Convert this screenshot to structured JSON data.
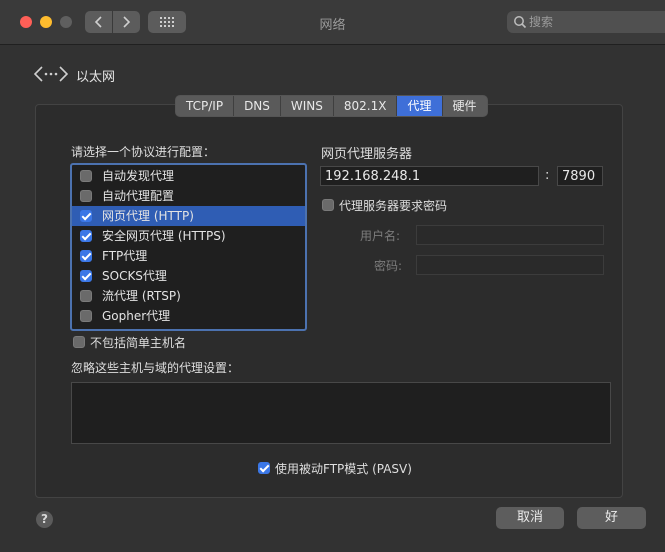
{
  "window": {
    "title": "网络",
    "search_placeholder": "搜索"
  },
  "interface": {
    "name": "以太网",
    "icon": "ethernet-icon"
  },
  "tabs": [
    {
      "label": "TCP/IP",
      "active": false
    },
    {
      "label": "DNS",
      "active": false
    },
    {
      "label": "WINS",
      "active": false
    },
    {
      "label": "802.1X",
      "active": false
    },
    {
      "label": "代理",
      "active": true
    },
    {
      "label": "硬件",
      "active": false
    }
  ],
  "proxy": {
    "protocol_prompt": "请选择一个协议进行配置：",
    "protocols": [
      {
        "label": "自动发现代理",
        "checked": false,
        "selected": false
      },
      {
        "label": "自动代理配置",
        "checked": false,
        "selected": false
      },
      {
        "label": "网页代理 (HTTP)",
        "checked": true,
        "selected": true
      },
      {
        "label": "安全网页代理 (HTTPS)",
        "checked": true,
        "selected": false
      },
      {
        "label": "FTP代理",
        "checked": true,
        "selected": false
      },
      {
        "label": "SOCKS代理",
        "checked": true,
        "selected": false
      },
      {
        "label": "流代理 (RTSP)",
        "checked": false,
        "selected": false
      },
      {
        "label": "Gopher代理",
        "checked": false,
        "selected": false
      }
    ],
    "server_heading": "网页代理服务器",
    "server_address": "192.168.248.1",
    "port_separator": ":",
    "server_port": "7890",
    "requires_password_label": "代理服务器要求密码",
    "requires_password": false,
    "username_label": "用户名:",
    "password_label": "密码:",
    "username_value": "",
    "password_value": "",
    "exclude_simple_hostnames_label": "不包括简单主机名",
    "exclude_simple_hostnames": false,
    "bypass_label": "忽略这些主机与域的代理设置：",
    "bypass_value": "",
    "passive_ftp_label": "使用被动FTP模式 (PASV)",
    "passive_ftp": true
  },
  "footer": {
    "help": "?",
    "cancel": "取消",
    "ok": "好"
  },
  "colors": {
    "accent": "#3e6fd8",
    "selection": "#2f5db4",
    "close": "#fe5f57",
    "minimize": "#febc2e"
  }
}
